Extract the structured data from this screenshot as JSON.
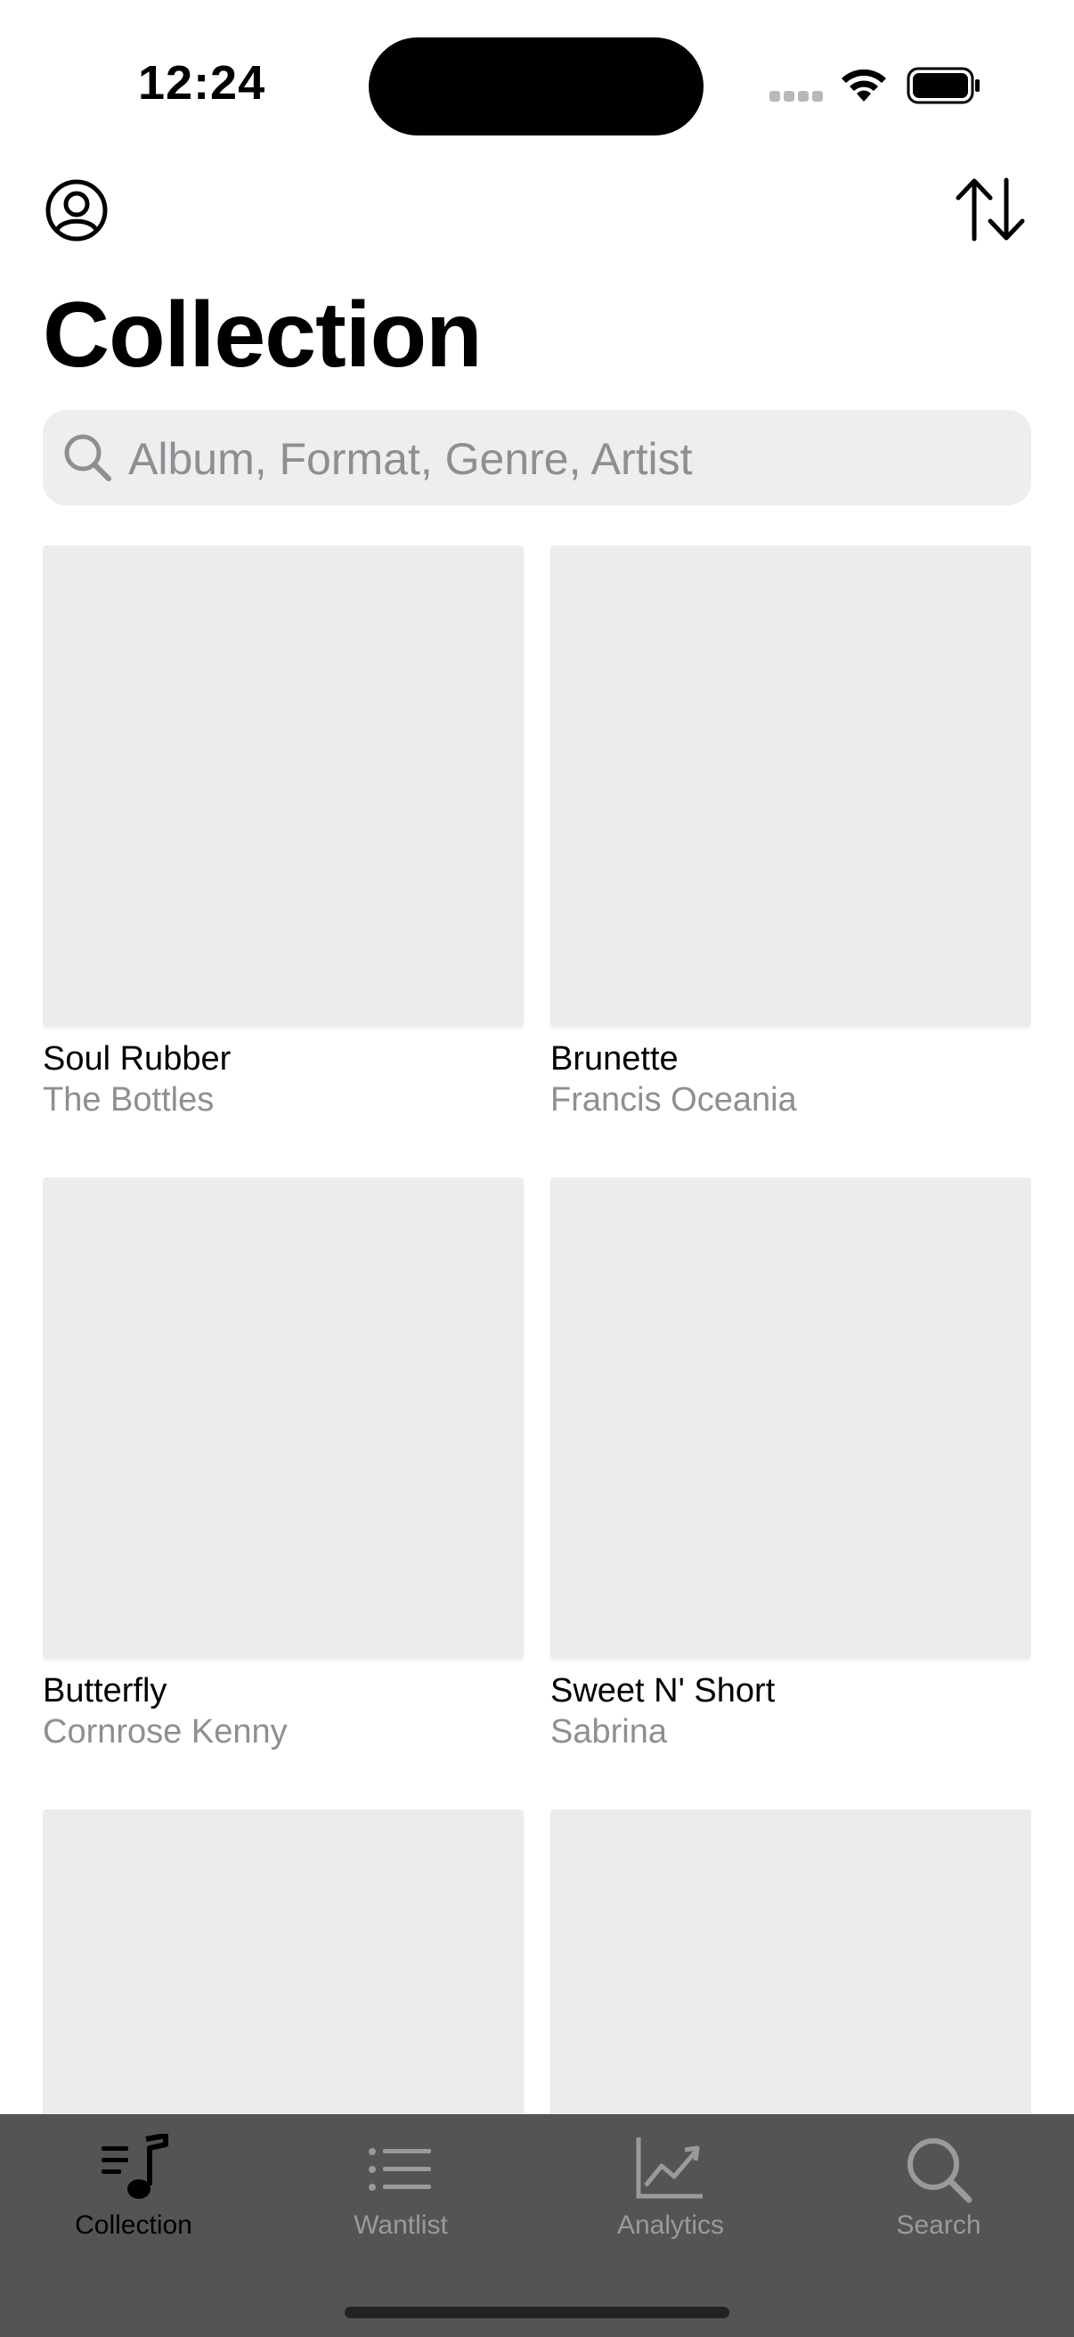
{
  "status_bar": {
    "time": "12:24"
  },
  "header": {
    "title": "Collection"
  },
  "search": {
    "placeholder": "Album, Format, Genre, Artist"
  },
  "albums": [
    {
      "title": "Soul Rubber",
      "artist": "The Bottles"
    },
    {
      "title": "Brunette",
      "artist": "Francis Oceania"
    },
    {
      "title": "Butterfly",
      "artist": "Cornrose Kenny"
    },
    {
      "title": "Sweet N' Short",
      "artist": "Sabrina"
    },
    {
      "title": "",
      "artist": ""
    },
    {
      "title": "",
      "artist": ""
    }
  ],
  "tabs": [
    {
      "label": "Collection",
      "icon": "music-list-icon",
      "active": true
    },
    {
      "label": "Wantlist",
      "icon": "list-icon",
      "active": false
    },
    {
      "label": "Analytics",
      "icon": "chart-icon",
      "active": false
    },
    {
      "label": "Search",
      "icon": "search-icon",
      "active": false
    }
  ],
  "colors": {
    "tab_bar_bg": "#545456",
    "tab_inactive": "#9a9a9c",
    "tab_active": "#000000",
    "cover_placeholder": "#ececee",
    "secondary_text": "#8e8e93"
  }
}
